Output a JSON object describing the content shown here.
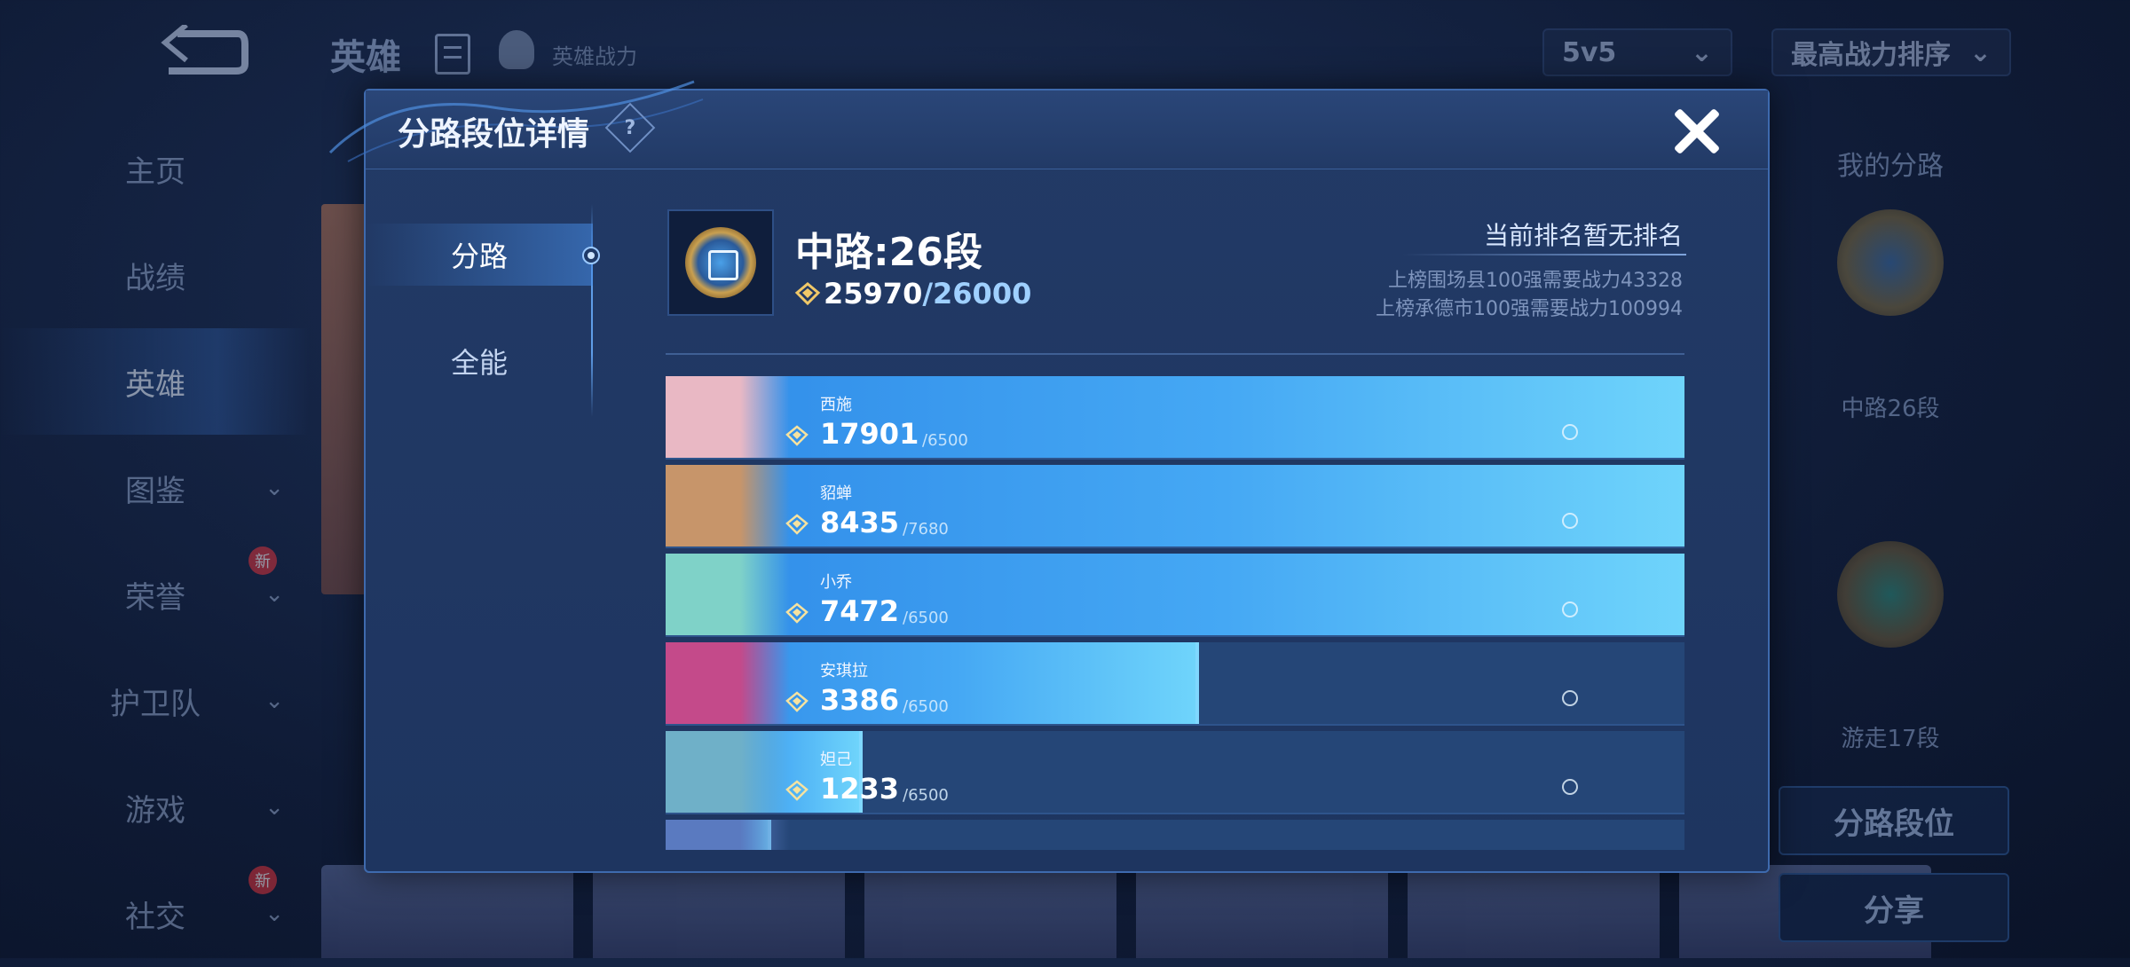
{
  "background": {
    "top_title": "英雄",
    "top_sub": "英雄战力",
    "mode_dropdown": "5v5",
    "sort_dropdown": "最高战力排序",
    "nav": [
      {
        "label": "主页",
        "chevron": false
      },
      {
        "label": "战绩",
        "chevron": false
      },
      {
        "label": "英雄",
        "chevron": false,
        "active": true
      },
      {
        "label": "图鉴",
        "chevron": true
      },
      {
        "label": "荣誉",
        "chevron": true,
        "badge": "新"
      },
      {
        "label": "护卫队",
        "chevron": true
      },
      {
        "label": "游戏",
        "chevron": true
      },
      {
        "label": "社交",
        "chevron": true,
        "badge": "新"
      }
    ],
    "right_panel": {
      "title": "我的分路",
      "lane1_label": "中路26段",
      "lane2_label": "游走17段",
      "btn_lane_rank": "分路段位",
      "btn_share": "分享"
    }
  },
  "modal": {
    "title": "分路段位详情",
    "help_glyph": "?",
    "tabs": [
      {
        "label": "分路",
        "active": true
      },
      {
        "label": "全能",
        "active": false
      }
    ],
    "lane_title": "中路:26段",
    "power_current": "25970",
    "power_separator": "/",
    "power_target": "26000",
    "rank_status": "当前排名暂无排名",
    "requirement_1": "上榜围场县100强需要战力43328",
    "requirement_2": "上榜承德市100强需要战力100994",
    "heroes": [
      {
        "name": "西施",
        "power": "17901",
        "max": "/6500",
        "fill": 1.0,
        "portrait": "#e9b8c4"
      },
      {
        "name": "貂蝉",
        "power": "8435",
        "max": "/7680",
        "fill": 1.0,
        "portrait": "#c7956a"
      },
      {
        "name": "小乔",
        "power": "7472",
        "max": "/6500",
        "fill": 1.0,
        "portrait": "#7fd2c8"
      },
      {
        "name": "安琪拉",
        "power": "3386",
        "max": "/6500",
        "fill": 0.52,
        "portrait": "#c44a8a"
      },
      {
        "name": "妲己",
        "power": "1233",
        "max": "/6500",
        "fill": 0.19,
        "portrait": "#6fb0c8"
      },
      {
        "name": "",
        "power": "",
        "max": "",
        "fill": 0.1,
        "portrait": "#5a7ac0"
      }
    ]
  }
}
